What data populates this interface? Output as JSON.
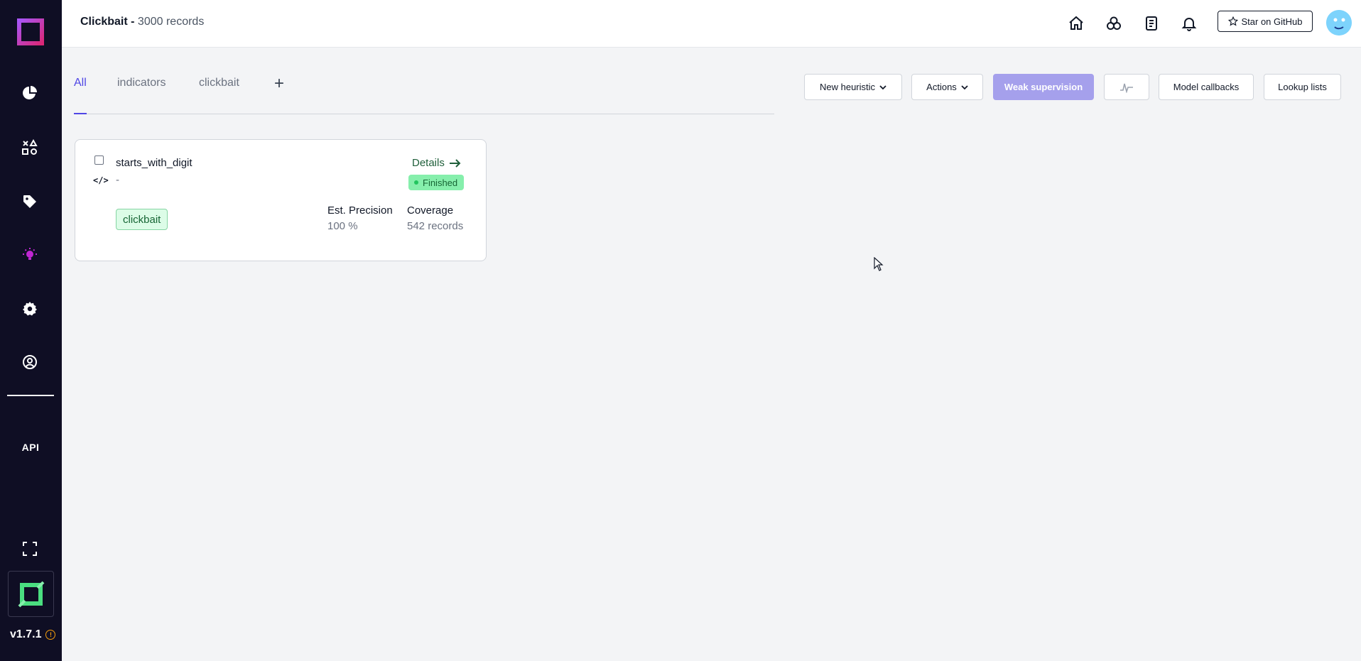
{
  "app": {
    "version": "v1.7.1"
  },
  "header": {
    "project_name": "Clickbait -",
    "record_count": "3000 records",
    "github_label": "Star on GitHub"
  },
  "sidebar": {
    "items": [
      {
        "icon": "pie-chart-icon"
      },
      {
        "icon": "shapes-icon"
      },
      {
        "icon": "tag-icon"
      },
      {
        "icon": "bulb-icon",
        "active": true
      },
      {
        "icon": "gear-icon"
      },
      {
        "icon": "user-circle-icon"
      }
    ],
    "api_label": "API"
  },
  "tabs": [
    {
      "label": "All",
      "active": true
    },
    {
      "label": "indicators"
    },
    {
      "label": "clickbait"
    }
  ],
  "toolbar": {
    "new_heuristic": "New heuristic",
    "actions": "Actions",
    "weak_supervision": "Weak supervision",
    "model_callbacks": "Model callbacks",
    "lookup_lists": "Lookup lists"
  },
  "heuristics": [
    {
      "name": "starts_with_digit",
      "description": "-",
      "details_label": "Details",
      "status": "Finished",
      "label": "clickbait",
      "precision_header": "Est. Precision",
      "precision_value": "100 %",
      "coverage_header": "Coverage",
      "coverage_value": "542 records"
    }
  ],
  "colors": {
    "sidebar_bg": "#0f0e24",
    "accent": "#4f46e5",
    "primary_button": "#a5a0ec",
    "status_finished": "#86efac",
    "active_sidebar_icon": "#c026d3"
  }
}
